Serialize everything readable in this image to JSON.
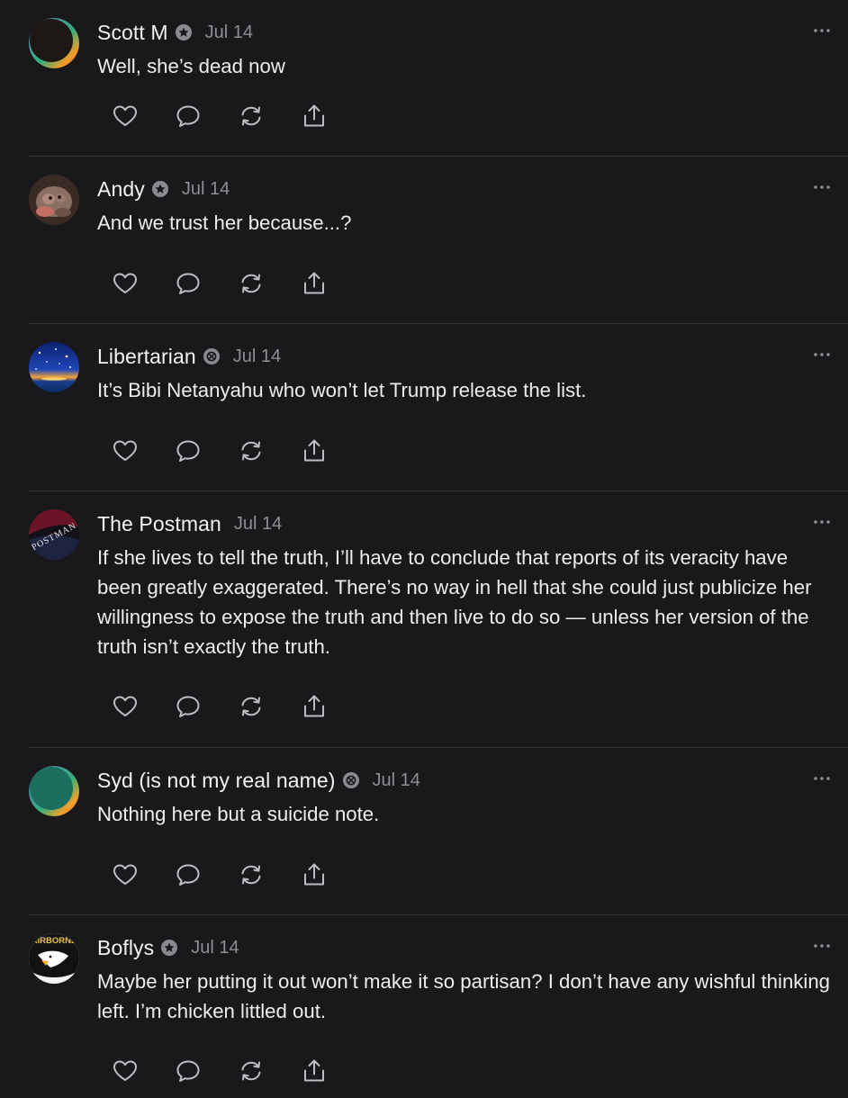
{
  "comments": [
    {
      "author": "Scott M",
      "date": "Jul 14",
      "text": "Well, she’s dead now",
      "avatar": "dark-sphere-rainbow-rim",
      "badge": "subscriber-star-badge"
    },
    {
      "author": "Andy",
      "date": "Jul 14",
      "text": "And we trust her because...?",
      "avatar": "photo-avatar",
      "badge": "subscriber-star-badge"
    },
    {
      "author": "Libertarian",
      "date": "Jul 14",
      "text": "It’s Bibi Netanyahu who won’t let Trump release the list.",
      "avatar": "starry-night-sunset",
      "badge": "subscriber-x-badge"
    },
    {
      "author": "The Postman",
      "date": "Jul 14",
      "text": "If she lives to tell the truth, I’ll have to conclude that reports of its veracity have been greatly exaggerated. There’s no way in hell that she could just publicize her willingness to expose the truth and then live to do so — unless her version of the truth isn’t exactly the truth.",
      "avatar": "postman-logo",
      "avatar_text": "POSTMAN",
      "badge": null
    },
    {
      "author": "Syd (is not my real name)",
      "date": "Jul 14",
      "text": "Nothing here but a suicide note.",
      "avatar": "green-sphere-rainbow-rim",
      "badge": "subscriber-x-badge"
    },
    {
      "author": "Boflys",
      "date": "Jul 14",
      "text": "Maybe her putting it out won’t make it so partisan? I don’t have any wishful thinking left. I’m chicken littled out.",
      "avatar": "airborne-eagle-patch",
      "avatar_text": "AIRBORNE",
      "badge": "subscriber-star-badge"
    }
  ],
  "actions": [
    "like-icon",
    "reply-icon",
    "restack-icon",
    "share-icon"
  ],
  "colors": {
    "background": "#19191c",
    "text": "#ececec",
    "muted": "#8e8e93",
    "icon": "#bdbdc2",
    "divider": "#35353a"
  }
}
